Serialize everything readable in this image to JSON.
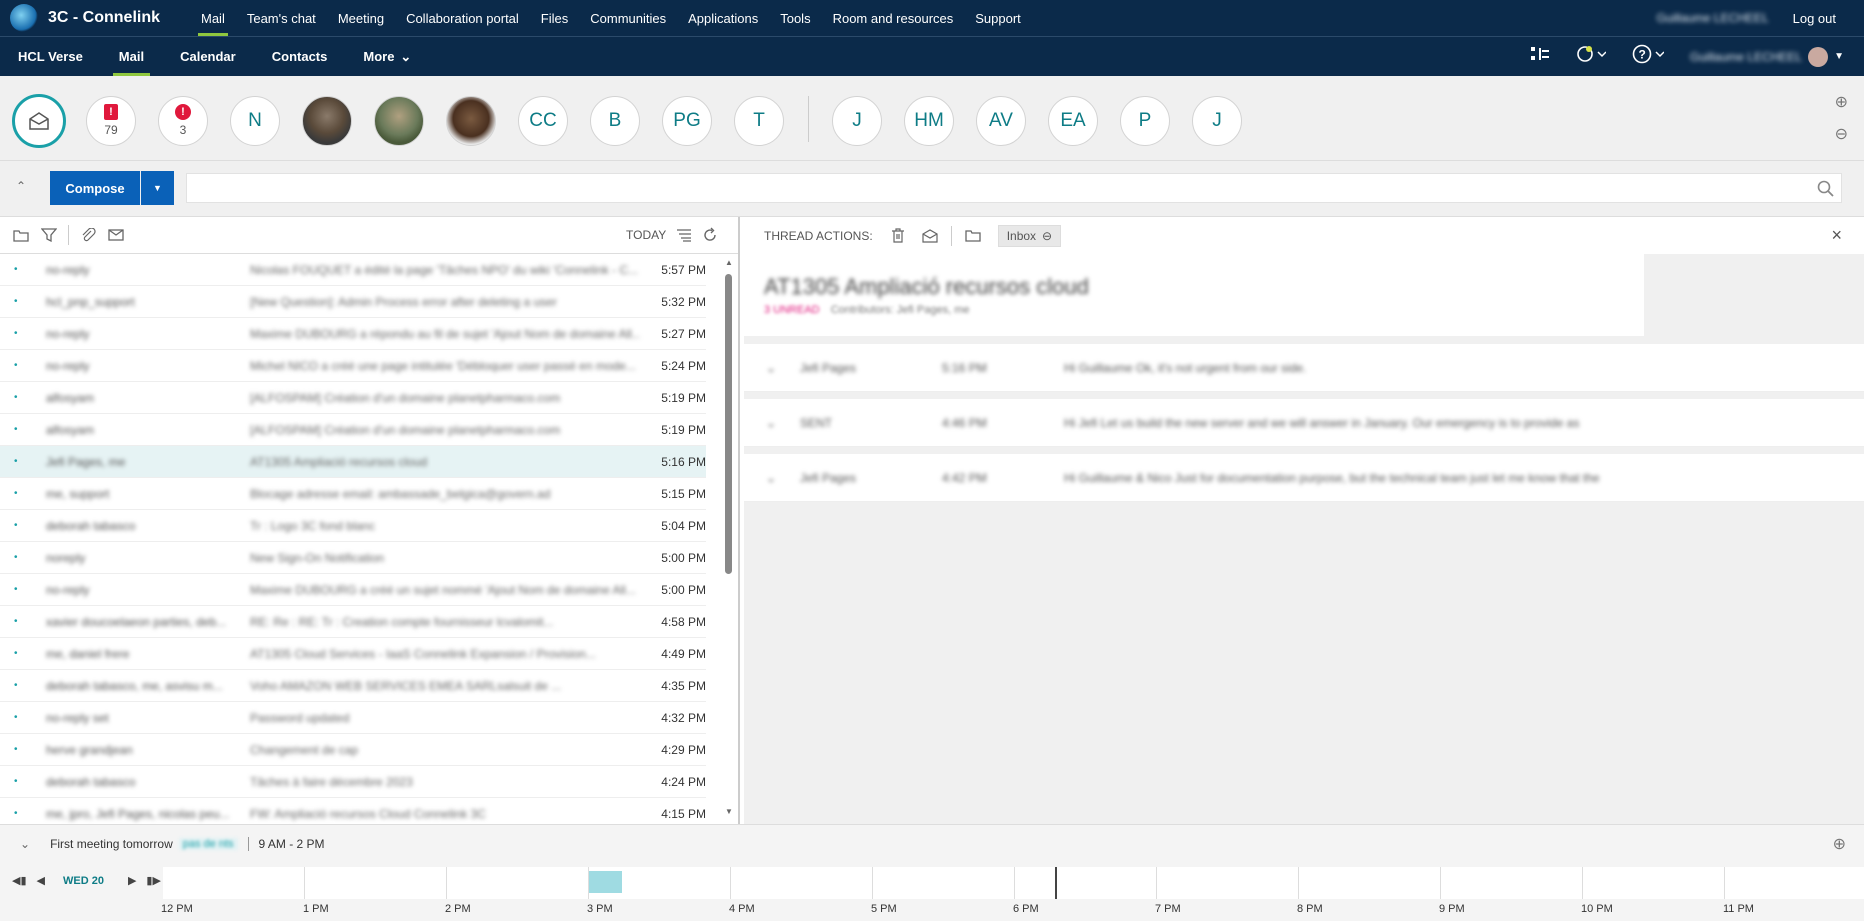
{
  "app": {
    "title": "3C - Connelink"
  },
  "topnav": [
    {
      "label": "Mail",
      "active": true
    },
    {
      "label": "Team's chat"
    },
    {
      "label": "Meeting"
    },
    {
      "label": "Collaboration portal"
    },
    {
      "label": "Files"
    },
    {
      "label": "Communities"
    },
    {
      "label": "Applications"
    },
    {
      "label": "Tools"
    },
    {
      "label": "Room and resources"
    },
    {
      "label": "Support"
    }
  ],
  "top_right": {
    "user": "Guillaume LECHEEL",
    "logout": "Log out"
  },
  "secnav": [
    {
      "label": "HCL Verse"
    },
    {
      "label": "Mail",
      "active": true
    },
    {
      "label": "Calendar"
    },
    {
      "label": "Contacts"
    },
    {
      "label": "More"
    }
  ],
  "sec_user": "Guillaume LECHEEL",
  "avatars": {
    "important_count": "79",
    "urgent_count": "3",
    "people": [
      "N",
      "CC",
      "B",
      "PG",
      "T",
      "J",
      "HM",
      "AV",
      "EA",
      "P",
      "J"
    ]
  },
  "compose": {
    "label": "Compose"
  },
  "list_toolbar": {
    "today": "TODAY"
  },
  "emails": [
    {
      "from": "no-reply",
      "subject": "Nicolas FOUQUET a édité la page 'Tâches NPO' du wiki 'Connelink - C...",
      "time": "5:57 PM"
    },
    {
      "from": "hcl_pnp_support",
      "subject": "[New Question]: Admin Process error after deleting a user",
      "time": "5:32 PM"
    },
    {
      "from": "no-reply",
      "subject": "Maxime DUBOURG a répondu au fil de sujet 'Ajout Nom de domaine All...",
      "time": "5:27 PM"
    },
    {
      "from": "no-reply",
      "subject": "Michel NICO a créé une page intitulée 'Débloquer user passé en mode...",
      "time": "5:24 PM"
    },
    {
      "from": "alfosyam",
      "subject": "[ALFOSPAM] Création d'un domaine planetpharmaco.com",
      "time": "5:19 PM"
    },
    {
      "from": "alfosyam",
      "subject": "[ALFOSPAM] Création d'un domaine planetpharmaco.com",
      "time": "5:19 PM"
    },
    {
      "from": "Jefi Pages, me",
      "subject": "AT1305 Ampliació recursos cloud",
      "time": "5:16 PM",
      "selected": true,
      "flag": true
    },
    {
      "from": "me, support",
      "subject": "Blocage adresse email: ambassade_belgica@govern.ad",
      "time": "5:15 PM"
    },
    {
      "from": "deborah tabasco",
      "subject": "Tr : Logo 3C fond blanc",
      "time": "5:04 PM"
    },
    {
      "from": "noreply",
      "subject": "New Sign-On Notification",
      "time": "5:00 PM"
    },
    {
      "from": "no-reply",
      "subject": "Maxime DUBOURG a créé un sujet nommé 'Ajout Nom de domaine All...",
      "time": "5:00 PM"
    },
    {
      "from": "xavier doucoelaeon parties, deb...",
      "subject": "RE: Re : RE: Tr : Creation compte fournisseur lcvalomit...",
      "time": "4:58 PM",
      "flag": true
    },
    {
      "from": "me, daniel frere",
      "subject": "AT1305 Cloud Services - IaaS Connelink Expansion / Provision...",
      "time": "4:49 PM"
    },
    {
      "from": "deborah tabasco, me, asvisu m...",
      "subject": "Voho AMAZON WEB SERVICES EMEA SARLsalsuit de ...",
      "time": "4:35 PM",
      "flag": true
    },
    {
      "from": "no-reply set",
      "subject": "Password updated",
      "time": "4:32 PM"
    },
    {
      "from": "herve grandjean",
      "subject": "Changement de cap",
      "time": "4:29 PM",
      "imp": true
    },
    {
      "from": "deborah tabasco",
      "subject": "Tâches à faire décembre 2023",
      "time": "4:24 PM"
    },
    {
      "from": "me, jpro, Jefi Pages, nicolas peu...",
      "subject": "FW: Ampliació recursos Cloud Connelink 3C",
      "time": "4:15 PM"
    }
  ],
  "thread": {
    "actions_label": "THREAD ACTIONS:",
    "folder": "Inbox",
    "title": "AT1305 Ampliació recursos cloud",
    "unread": "3 UNREAD",
    "contributors": "Contributors: Jefi Pages, me",
    "messages": [
      {
        "from": "Jefi Pages",
        "time": "5:16 PM",
        "preview": "Hi Guillaume Ok, it's not urgent from our side."
      },
      {
        "from": "SENT",
        "time": "4:46 PM",
        "preview": "Hi Jefi Let us build the new server and we will answer in January. Our emergency is to provide as"
      },
      {
        "from": "Jefi Pages",
        "time": "4:42 PM",
        "preview": "Hi Guillaume & Nico Just for documentation purpose, but the technical team just let me know that the"
      }
    ]
  },
  "meeting": {
    "title": "First meeting tomorrow",
    "tag": "pas de nts",
    "time": "9 AM - 2 PM"
  },
  "timeline": {
    "day": "WED 20",
    "hours": [
      "12 PM",
      "1 PM",
      "2 PM",
      "3 PM",
      "4 PM",
      "5 PM",
      "6 PM",
      "7 PM",
      "8 PM",
      "9 PM",
      "10 PM",
      "11 PM"
    ]
  }
}
